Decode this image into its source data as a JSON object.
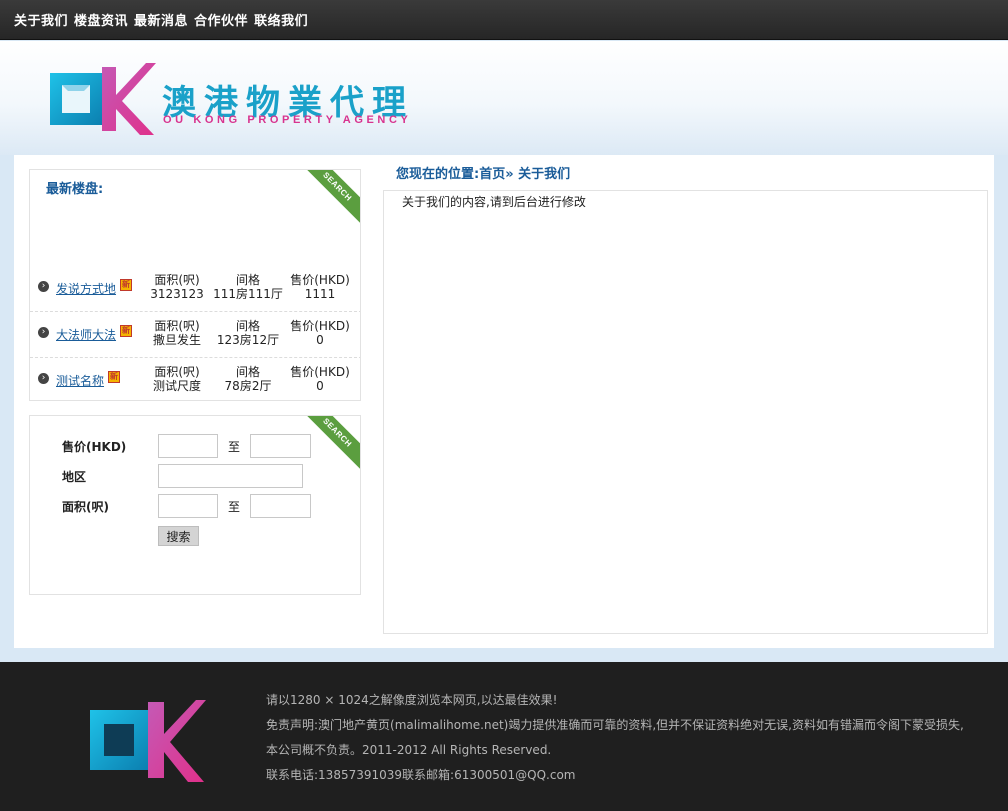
{
  "nav": {
    "items": [
      "关于我们",
      "楼盘资讯",
      "最新消息",
      "合作伙伴",
      "联络我们"
    ]
  },
  "header": {
    "brand_cn": "澳港物業代理",
    "brand_en": "OU KONG PROPERTY AGENCY"
  },
  "latest": {
    "title": "最新楼盘:",
    "badge": "SEARCH",
    "listings": [
      {
        "name": "发说方式地",
        "area_label": "面积(呎)",
        "area": "3123123",
        "layout_label": "间格",
        "layout": "111房111厅",
        "price_label": "售价(HKD)",
        "price": "1111"
      },
      {
        "name": "大法师大法",
        "area_label": "面积(呎)",
        "area": "撒旦发生",
        "layout_label": "间格",
        "layout": "123房12厅",
        "price_label": "售价(HKD)",
        "price": "0"
      },
      {
        "name": "测试名称",
        "area_label": "面积(呎)",
        "area": "测试尺度",
        "layout_label": "间格",
        "layout": "78房2厅",
        "price_label": "售价(HKD)",
        "price": "0"
      }
    ]
  },
  "search": {
    "badge": "SEARCH",
    "price_label": "售价(HKD)",
    "region_label": "地区",
    "area_label": "面积(呎)",
    "to": "至",
    "button": "搜索"
  },
  "breadcrumb": "您现在的位置:首页» 关于我们",
  "content": {
    "text": "关于我们的内容,请到后台进行修改"
  },
  "footer": {
    "line1": "请以1280 × 1024之解像度浏览本网页,以达最佳效果!",
    "line2": "免责声明:澳门地产黄页(malimalihome.net)竭力提供准确而可靠的资料,但并不保证资料绝对无误,资料如有错漏而令阁下蒙受损失,",
    "line3": "本公司概不负责。2011-2012 All Rights Reserved.",
    "line4": "联系电话:13857391039联系邮箱:61300501@QQ.com"
  },
  "colors": {
    "accent": "#1a5c99",
    "brand_cyan": "#1aa1c9",
    "brand_pink": "#d8348f",
    "badge_green": "#5b9e3f"
  }
}
